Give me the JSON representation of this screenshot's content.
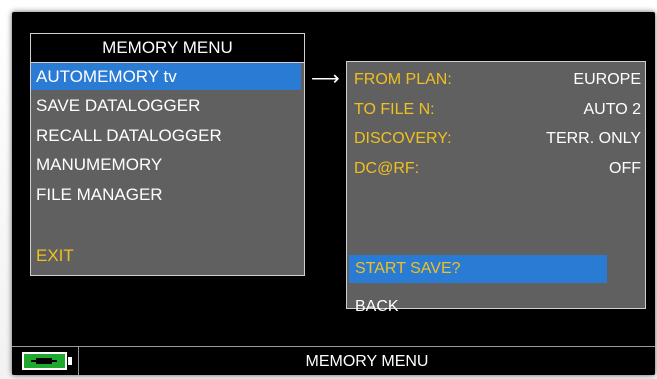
{
  "memory_menu": {
    "title": "MEMORY MENU",
    "items": [
      {
        "label": "AUTOMEMORY tv"
      },
      {
        "label": "SAVE DATALOGGER"
      },
      {
        "label": "RECALL DATALOGGER"
      },
      {
        "label": "MANUMEMORY"
      },
      {
        "label": "FILE MANAGER"
      },
      {
        "label": "EXIT"
      }
    ],
    "selected_index": 0
  },
  "arrow_icon": "right-arrow-icon",
  "settings": {
    "rows": [
      {
        "label": "FROM PLAN:",
        "value": "EUROPE"
      },
      {
        "label": "TO FILE N:",
        "value": "AUTO 2"
      },
      {
        "label": "DISCOVERY:",
        "value": "TERR. ONLY"
      },
      {
        "label": "DC@RF:",
        "value": "OFF"
      }
    ],
    "start_save": "START SAVE?",
    "back": "BACK"
  },
  "status_bar": {
    "title": "MEMORY MENU",
    "battery_icon": "battery-charging-icon"
  },
  "colors": {
    "highlight": "#2a7bd4",
    "label_yellow": "#f0c020",
    "panel_gray": "#606060",
    "battery_green": "#1ea82e"
  }
}
